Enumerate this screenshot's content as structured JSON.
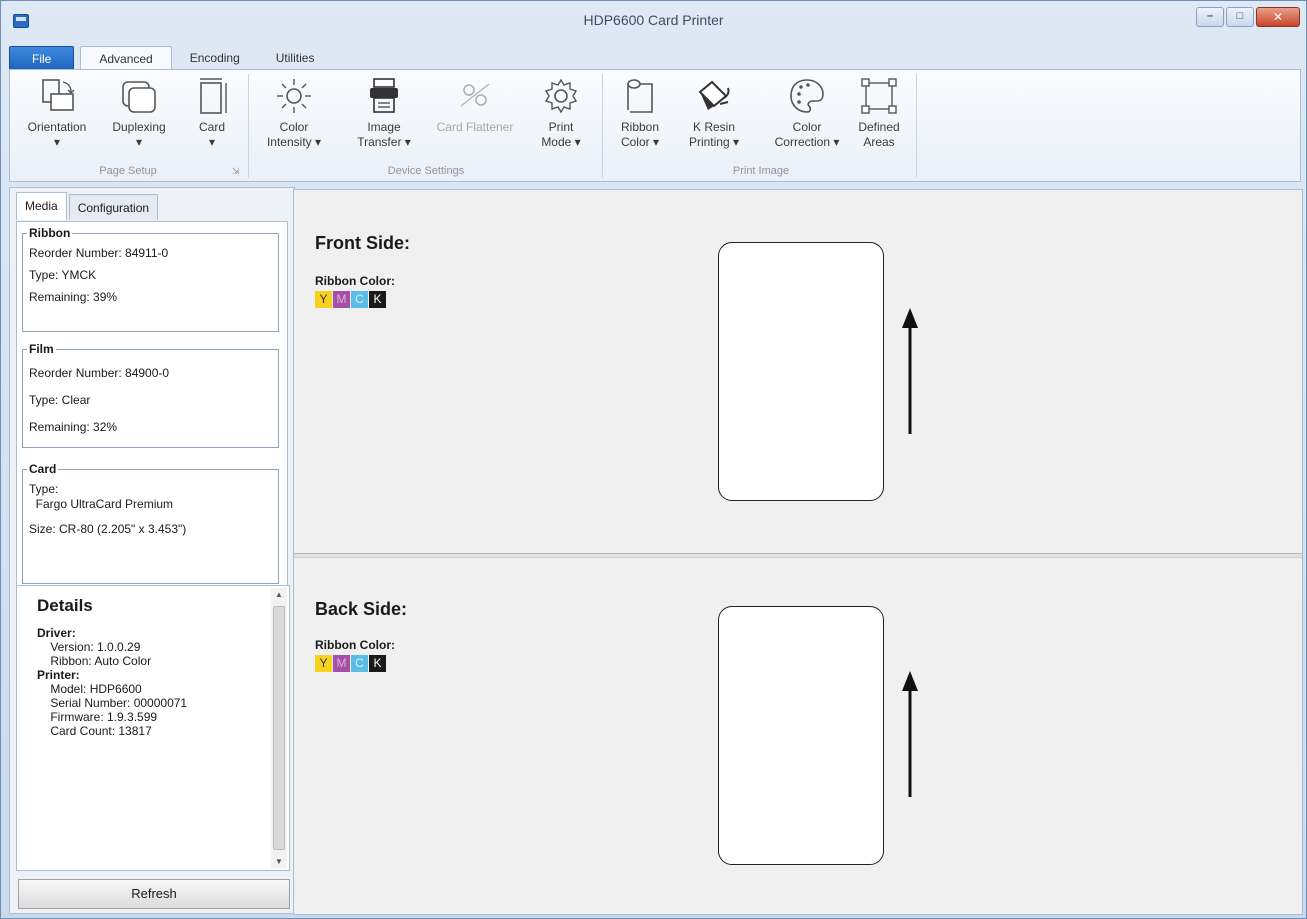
{
  "window": {
    "title": "HDP6600 Card Printer"
  },
  "colors": {
    "yellow": "#f7d21c",
    "magenta": "#a64fa8",
    "cyan": "#5bbde3",
    "black": "#1a1a1a"
  },
  "ribbon_tabs": [
    {
      "label": "File"
    },
    {
      "label": "Advanced"
    },
    {
      "label": "Encoding"
    },
    {
      "label": "Utilities"
    }
  ],
  "ribbon": {
    "groups": {
      "page_setup": "Page Setup",
      "device_settings": "Device Settings",
      "print_image": "Print Image"
    },
    "buttons": {
      "orientation": [
        "Orientation",
        "▾"
      ],
      "duplexing": [
        "Duplexing",
        "▾"
      ],
      "card": [
        "Card",
        "▾"
      ],
      "color_intensity": [
        "Color",
        "Intensity ▾"
      ],
      "image_transfer": [
        "Image",
        "Transfer ▾"
      ],
      "card_flattener": [
        "Card Flattener"
      ],
      "print_mode": [
        "Print",
        "Mode ▾"
      ],
      "ribbon_color": [
        "Ribbon",
        "Color ▾"
      ],
      "k_resin": [
        "K Resin",
        "Printing ▾"
      ],
      "color_correction": [
        "Color",
        "Correction ▾"
      ],
      "defined_areas": [
        "Defined",
        "Areas"
      ]
    }
  },
  "panel_tabs": [
    "Media",
    "Configuration"
  ],
  "media": {
    "ribbon": {
      "legend": "Ribbon",
      "lines": [
        "Reorder Number: 84911-0",
        "Type: YMCK",
        "Remaining: 39%"
      ]
    },
    "film": {
      "legend": "Film",
      "lines": [
        "Reorder Number: 84900-0",
        "Type: Clear",
        "Remaining: 32%"
      ]
    },
    "card": {
      "legend": "Card",
      "lines": [
        "Type:",
        "  Fargo UltraCard Premium",
        "Size: CR-80 (2.205\" x 3.453\")"
      ]
    }
  },
  "details": {
    "title": "Details",
    "driver_label": "Driver:",
    "driver_lines": "    Version: 1.0.0.29\n    Ribbon: Auto Color",
    "printer_label": "Printer:",
    "printer_lines": "    Model: HDP6600\n    Serial Number: 00000071\n    Firmware: 1.9.3.599\n    Card Count: 13817"
  },
  "refresh_label": "Refresh",
  "front": {
    "title": "Front Side:",
    "ribbon_label": "Ribbon Color:",
    "panels": [
      "Y",
      "M",
      "C",
      "K"
    ]
  },
  "back": {
    "title": "Back Side:",
    "ribbon_label": "Ribbon Color:",
    "panels": [
      "Y",
      "M",
      "C",
      "K"
    ]
  }
}
